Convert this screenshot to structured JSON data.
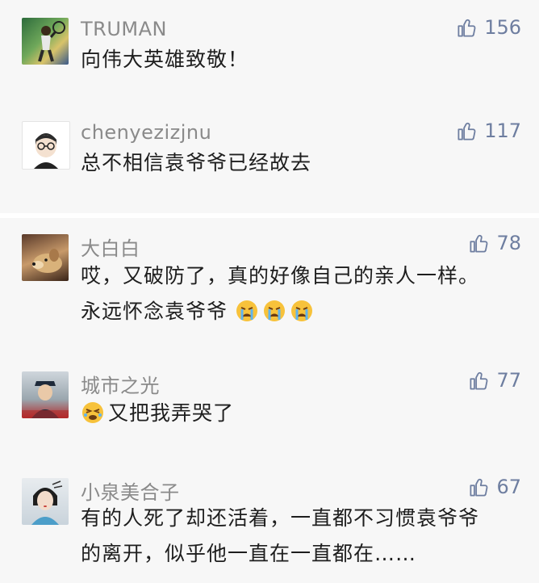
{
  "comments": [
    {
      "user": "TRUMAN",
      "likes": "156",
      "lines": [
        "向伟大英雄致敬！"
      ],
      "avatar": "tennis-player-avatar"
    },
    {
      "user": "chenyezizjnu",
      "likes": "117",
      "lines": [
        "总不相信袁爷爷已经故去"
      ],
      "avatar": "cartoon-glasses-avatar"
    },
    {
      "user": "大白白",
      "likes": "78",
      "lines": [
        "哎，又破防了，真的好像自己的亲人一样。",
        "永远怀念袁爷爷"
      ],
      "avatar": "dog-avatar",
      "trailing_emoji": "crying-emoji",
      "trailing_emoji_count": 3
    },
    {
      "user": "城市之光",
      "likes": "77",
      "lines": [
        "又把我弄哭了"
      ],
      "avatar": "uniform-person-avatar",
      "leading_emoji": "sobbing-emoji"
    },
    {
      "user": "小泉美合子",
      "likes": "67",
      "lines": [
        "有的人死了却还活着，一直都不习惯袁爷爷",
        "的离开，似乎他一直在一直都在……"
      ],
      "avatar": "illustrated-woman-avatar"
    }
  ],
  "colors": {
    "name": "#8a8a8a",
    "likes": "#6e7ea0",
    "text": "#1e1e1e",
    "background": "#f7f7f7"
  },
  "icons": {
    "like": "thumbs-up-outline-icon"
  }
}
